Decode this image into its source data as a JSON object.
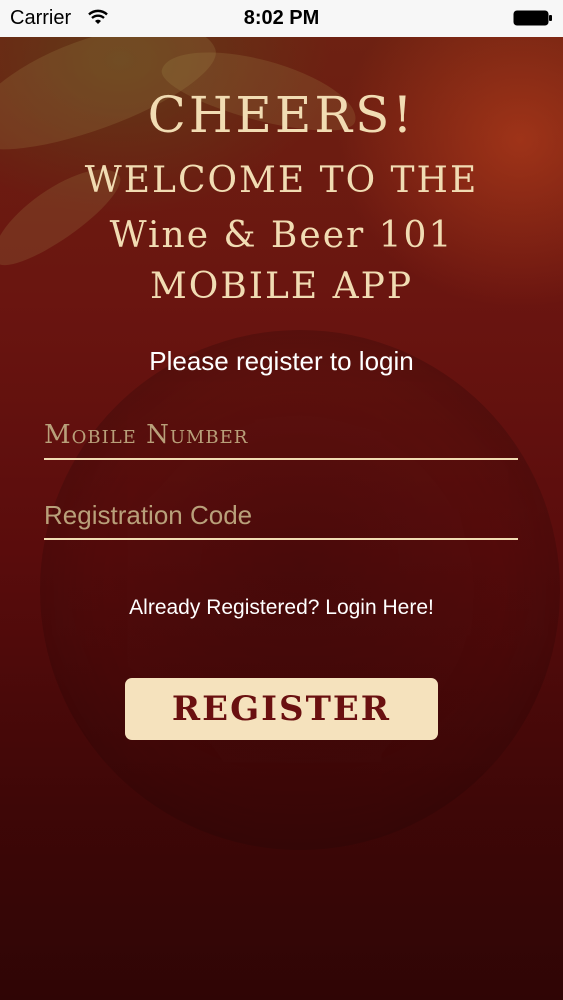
{
  "status_bar": {
    "carrier": "Carrier",
    "time": "8:02 PM",
    "wifi_icon": "wifi-icon",
    "battery_icon": "battery-icon"
  },
  "welcome": {
    "line1": "CHEERS!",
    "line2": "WELCOME TO THE",
    "line3": "Wine & Beer 101",
    "line4": "MOBILE APP"
  },
  "subtitle": "Please register to login",
  "form": {
    "mobile_placeholder": "Mobile Number",
    "mobile_value": "",
    "code_placeholder": "Registration Code",
    "code_value": ""
  },
  "login_link": "Already Registered? Login Here!",
  "register_button": "REGISTER",
  "colors": {
    "accent_cream": "#f5e2bd",
    "heading_text": "#f1dcb3",
    "background_wine": "#5a0c0c",
    "button_text": "#6a1010"
  }
}
